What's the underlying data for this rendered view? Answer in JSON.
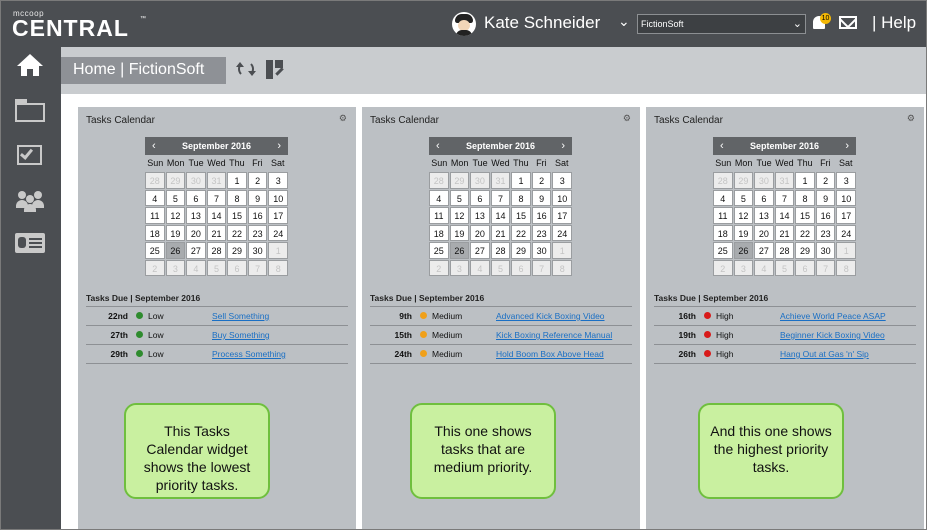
{
  "app": {
    "logo_small": "mccoop",
    "logo_big": "CENTRAL",
    "logo_tm": "™"
  },
  "header": {
    "user_name": "Kate Schneider",
    "user_caret": "⌄",
    "org_select": "FictionSoft",
    "notification_count": "10",
    "help": "| Help"
  },
  "breadcrumb": "Home  |  FictionSoft",
  "widgets": [
    {
      "title": "Tasks Calendar",
      "month": "September 2016",
      "tasks_heading": "Tasks Due | September 2016",
      "callout": "This Tasks Calendar widget shows the lowest priority tasks.",
      "flags": {
        "22": "low",
        "27": "low",
        "29": "low"
      },
      "tasks": [
        {
          "date": "22nd",
          "priority": "Low",
          "level": "low",
          "title": "Sell Something"
        },
        {
          "date": "27th",
          "priority": "Low",
          "level": "low",
          "title": "Buy Something"
        },
        {
          "date": "29th",
          "priority": "Low",
          "level": "low",
          "title": "Process Something"
        }
      ]
    },
    {
      "title": "Tasks Calendar",
      "month": "September 2016",
      "tasks_heading": "Tasks Due | September 2016",
      "callout": "This one shows tasks that are medium priority.",
      "flags": {
        "9": "medium",
        "15": "medium",
        "24": "medium"
      },
      "tasks": [
        {
          "date": "9th",
          "priority": "Medium",
          "level": "medium",
          "title": "Advanced Kick Boxing Video"
        },
        {
          "date": "15th",
          "priority": "Medium",
          "level": "medium",
          "title": "Kick Boxing Reference Manual"
        },
        {
          "date": "24th",
          "priority": "Medium",
          "level": "medium",
          "title": "Hold Boom Box Above Head"
        }
      ]
    },
    {
      "title": "Tasks Calendar",
      "month": "September 2016",
      "tasks_heading": "Tasks Due | September 2016",
      "callout": "And this one shows the highest priority tasks.",
      "flags": {
        "16": "high",
        "19": "high",
        "26": "high"
      },
      "tasks": [
        {
          "date": "16th",
          "priority": "High",
          "level": "high",
          "title": "Achieve World Peace ASAP"
        },
        {
          "date": "19th",
          "priority": "High",
          "level": "high",
          "title": "Beginner Kick Boxing Video"
        },
        {
          "date": "26th",
          "priority": "High",
          "level": "high",
          "title": "Hang Out at Gas 'n' Sip"
        }
      ]
    }
  ],
  "calendar": {
    "weekdays": [
      "Sun",
      "Mon",
      "Tue",
      "Wed",
      "Thu",
      "Fri",
      "Sat"
    ],
    "prev_label": "‹",
    "next_label": "›",
    "today": "26",
    "days": [
      "28",
      "29",
      "30",
      "31",
      "1",
      "2",
      "3",
      "4",
      "5",
      "6",
      "7",
      "8",
      "9",
      "10",
      "11",
      "12",
      "13",
      "14",
      "15",
      "16",
      "17",
      "18",
      "19",
      "20",
      "21",
      "22",
      "23",
      "24",
      "25",
      "26",
      "27",
      "28",
      "29",
      "30",
      "1",
      "2",
      "3",
      "4",
      "5",
      "6",
      "7",
      "8"
    ],
    "other_month": [
      true,
      true,
      true,
      true,
      false,
      false,
      false,
      false,
      false,
      false,
      false,
      false,
      false,
      false,
      false,
      false,
      false,
      false,
      false,
      false,
      false,
      false,
      false,
      false,
      false,
      false,
      false,
      false,
      false,
      false,
      false,
      false,
      false,
      false,
      true,
      true,
      true,
      true,
      true,
      true,
      true,
      true
    ]
  },
  "colors": {
    "low": "#2e8b2e",
    "medium": "#f0a01a",
    "high": "#d81a1a",
    "link": "#1a6fc4"
  },
  "icons": [
    "home-icon",
    "folder-icon",
    "checkbox-icon",
    "people-icon",
    "contact-card-icon",
    "refresh-icon",
    "edit-layout-icon",
    "gear-icon",
    "bell-icon",
    "mail-icon"
  ]
}
